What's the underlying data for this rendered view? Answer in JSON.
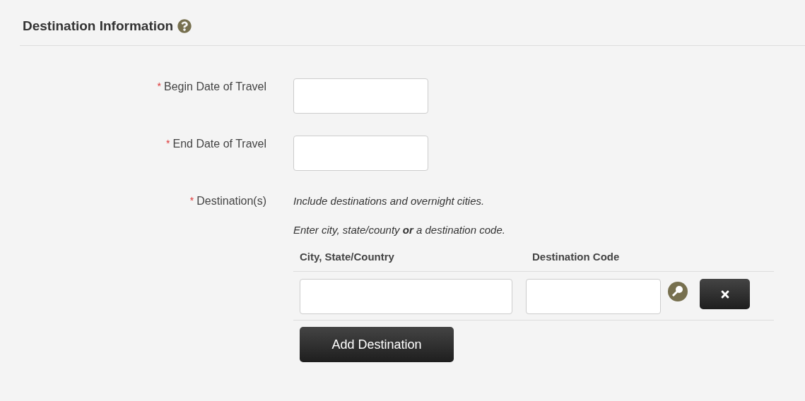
{
  "section": {
    "title": "Destination Information"
  },
  "fields": [
    {
      "kind": "input",
      "required_mark": "*",
      "label": "Begin Date of Travel"
    },
    {
      "kind": "input",
      "required_mark": "*",
      "label": "End Date of Travel"
    },
    {
      "kind": "destinations",
      "required_mark": "*",
      "label": "Destination(s)",
      "notes": [
        "Include destinations and overnight cities.",
        "Enter city, state/county **or** a destination code."
      ],
      "columns": [
        "City, State/Country",
        "Destination Code"
      ],
      "add_button": "Add Destination"
    }
  ]
}
